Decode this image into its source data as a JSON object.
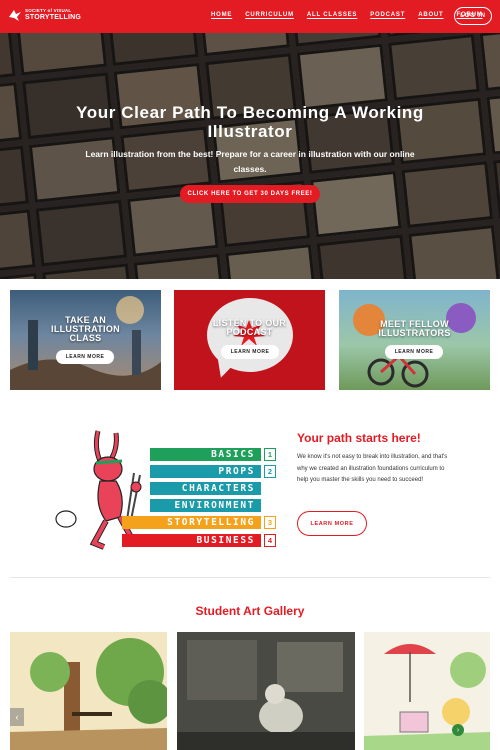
{
  "nav": {
    "logo": {
      "line1": "SOCIETY of VISUAL",
      "line2": "STORYTELLING"
    },
    "menu": [
      "HOME",
      "CURRICULUM",
      "ALL CLASSES",
      "PODCAST",
      "ABOUT",
      "FORUM"
    ],
    "login": "LOG IN"
  },
  "hero": {
    "title": "Your Clear Path To Becoming A Working Illustrator",
    "subtitle": "Learn illustration from the best! Prepare for a career in illustration with our online classes.",
    "cta": "CLICK HERE TO GET 30 DAYS FREE!"
  },
  "cards": [
    {
      "title_lines": [
        "TAKE AN",
        "ILLUSTRATION",
        "CLASS"
      ],
      "button": "LEARN MORE"
    },
    {
      "title_lines": [
        "LISTEN TO OUR",
        "PODCAST"
      ],
      "button": "LEARN MORE"
    },
    {
      "title_lines": [
        "MEET FELLOW",
        "ILLUSTRATORS"
      ],
      "button": "LEARN MORE"
    }
  ],
  "path": {
    "steps": [
      {
        "label": "BASICS",
        "num": "1"
      },
      {
        "label": "PROPS",
        "num": "2"
      },
      {
        "label": "CHARACTERS",
        "num": ""
      },
      {
        "label": "ENVIRONMENT",
        "num": ""
      },
      {
        "label": "STORYTELLING",
        "num": "3"
      },
      {
        "label": "BUSINESS",
        "num": "4"
      }
    ],
    "title": "Your path starts here!",
    "text": "We know it's not easy to break into illustration, and that's why we created an illustration foundations curriculum to help you master the skills you need to succeed!",
    "button": "LEARN MORE"
  },
  "gallery": {
    "title": "Student Art Gallery",
    "prev_icon": "‹",
    "next_icon": "›"
  },
  "colors": {
    "brand_red": "#e31b23",
    "green": "#1fa05a",
    "teal": "#1b9aaa",
    "orange": "#f4a21b"
  },
  "icons": [
    "logo-bird-icon",
    "splat-icon",
    "chevron-left-icon",
    "chevron-right-icon"
  ]
}
